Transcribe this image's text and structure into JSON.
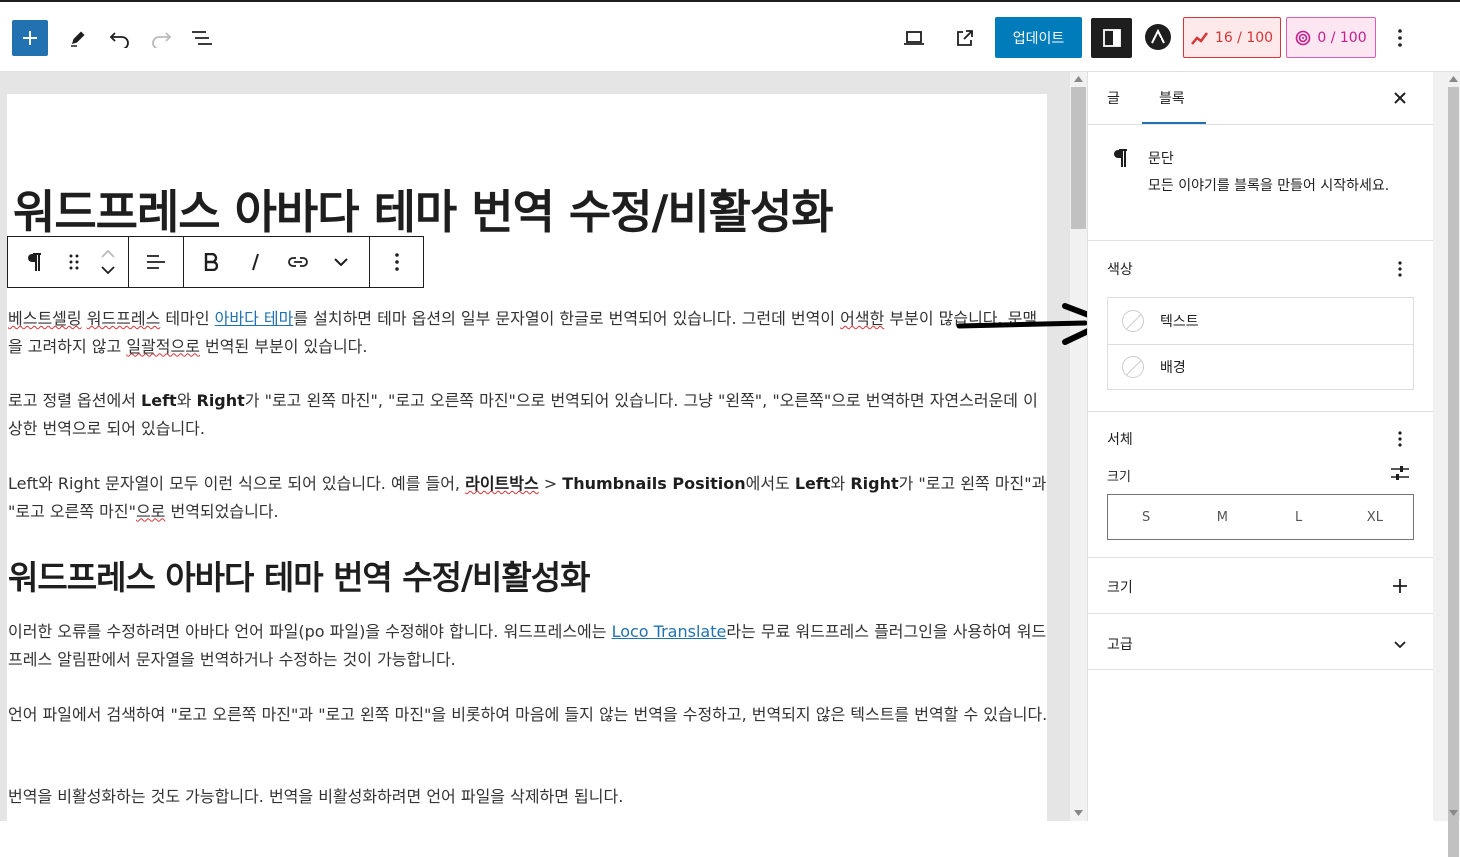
{
  "toolbar": {
    "update_label": "업데이트",
    "seo_score": "16 / 100",
    "readability_score": "0 / 100"
  },
  "editor": {
    "title": "워드프레스 아바다 테마 번역 수정/비활성화",
    "p1": {
      "seg1": "베스트셀링",
      "seg2": " ",
      "seg3": "워드프레스",
      "seg4": " 테마인 ",
      "link": "아바다 테마",
      "seg5": "를 설치하면 테마 옵션의 일부 문자열이 한글로 번역되어 있습니다. 그런데 번역이 ",
      "seg6": "어색한",
      "seg7": " 부분이 많습니다. 문맥을 고려하지 않고 ",
      "seg8": "일괄적으로",
      "seg9": " 번역된 부분이 있습니다."
    },
    "p2": {
      "seg1": "로고 정렬 옵션에서 ",
      "bold1": "Left",
      "seg2": "와 ",
      "bold2": "Right",
      "seg3": "가 \"로고 왼쪽 마진\", \"로고 오른쪽 마진\"으로 번역되어 있습니다. 그냥 \"왼쪽\", \"오른쪽\"으로 번역하면 자연스러운데 이상한 번역으로 되어 있습니다."
    },
    "p3": {
      "seg1": "Left와 Right 문자열이 모두 이런 식으로 되어 있습니다. 예를 들어, ",
      "bold1": "라이트박스",
      "seg2": " > ",
      "bold2": "Thumbnails Position",
      "seg3": "에서도 ",
      "bold3": "Left",
      "seg4": "와 ",
      "bold4": "Right",
      "seg5": "가 \"로고 왼쪽 마진\"과 \"로고 오른쪽 마진\"",
      "seg6": "으로",
      "seg7": " 번역되었습니다."
    },
    "heading2": "워드프레스 아바다 테마 번역 수정/비활성화",
    "p4": {
      "seg1": "이러한 오류를 수정하려면 아바다 언어 파일(po 파일)을 수정해야 합니다. 워드프레스에는 ",
      "link": "Loco Translate",
      "seg2": "라는 무료 워드프레스 플러그인을 사용하여 워드프레스 알림판에서 문자열을 번역하거나 수정하는 것이 가능합니다."
    },
    "p5": "언어 파일에서 검색하여 \"로고 오른쪽 마진\"과 \"로고 왼쪽 마진\"을 비롯하여 마음에 들지 않는 번역을 수정하고, 번역되지 않은 텍스트를 번역할 수 있습니다.",
    "p6": "번역을 비활성화하는 것도 가능합니다. 번역을 비활성화하려면 언어 파일을 삭제하면 됩니다."
  },
  "sidebar": {
    "tabs": [
      "글",
      "블록"
    ],
    "block_name": "문단",
    "block_desc": "모든 이야기를 블록을 만들어 시작하세요.",
    "color_section": "색상",
    "color_items": [
      "텍스트",
      "배경"
    ],
    "typography_section": "서체",
    "size_label": "크기",
    "size_options": [
      "S",
      "M",
      "L",
      "XL"
    ],
    "dimensions_section": "크기",
    "advanced_section": "고급"
  },
  "colors": {
    "primary": "#007cba",
    "seo": "#d63638",
    "readability": "#c51d8a"
  }
}
